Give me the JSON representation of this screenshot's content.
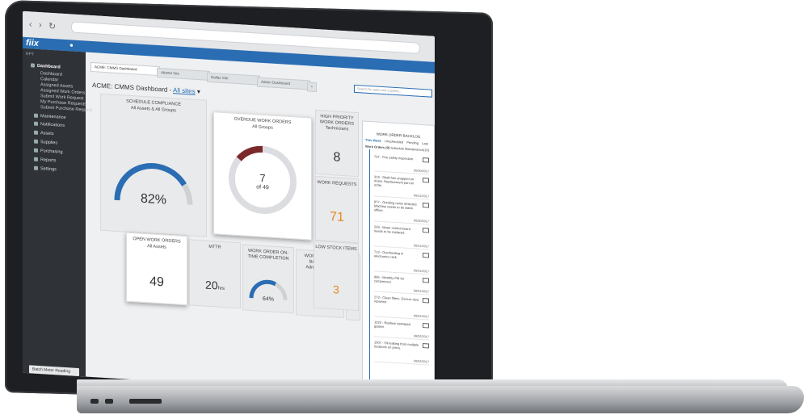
{
  "app": {
    "logo": "fiix"
  },
  "sidebar": {
    "head": "RPT",
    "dashboard": "Dashboard",
    "sub_items": [
      "Dashboard",
      "Calendar",
      "Assigned Assets",
      "Assigned Work Orders",
      "Submit Work Request",
      "My Purchase Requests",
      "Submit Purchase Request"
    ],
    "items": [
      "Maintenance",
      "Notifications",
      "Assets",
      "Supplies",
      "Purchasing",
      "Reports",
      "Settings"
    ],
    "batch": "Batch Meter Reading",
    "help": "Help",
    "logoff": "Log Off"
  },
  "tabs": [
    "ACME: CMMS Dashboard",
    "Atlanta Site",
    "Dallas Site",
    "Admin Dashboard"
  ],
  "search": {
    "placeholder": "Search for parts and supplies..."
  },
  "dashboard": {
    "title": "ACME: CMMS Dashboard -",
    "sites_link": "All sites"
  },
  "tiles": {
    "schedule": {
      "title": "SCHEDULE COMPLIANCE",
      "subtitle": "All Assets & All Groups",
      "value": "82%",
      "level": 0.82
    },
    "overdue": {
      "title": "OVERDUE WORK ORDERS",
      "subtitle": "All Groups",
      "value": "7",
      "of": "of 49",
      "level": 0.14
    },
    "high_priority": {
      "title": "HIGH PRIORITY WORK ORDERS",
      "subtitle": "Technicians",
      "value": "8"
    },
    "requests": {
      "title": "WORK REQUESTS",
      "value": "71"
    },
    "open": {
      "title": "OPEN WORK ORDERS",
      "subtitle": "All Assets",
      "value": "49"
    },
    "mttr": {
      "title": "MTTR",
      "value": "20",
      "unit": "hrs"
    },
    "ontime": {
      "title": "WORK ORDER ON-TIME COMPLETION",
      "value": "64%",
      "level": 0.64
    },
    "backlog": {
      "title": "WORK ORDER BACKLOG",
      "subtitle": "Administrators",
      "value": "1",
      "unit": "w"
    },
    "low_stock": {
      "title": "LOW STOCK ITEMS",
      "value": "3"
    }
  },
  "backlog_panel": {
    "title": "WORK ORDER BACKLOG",
    "tabs": [
      "This Week",
      "Unscheduled",
      "Pending",
      "Late"
    ],
    "filter_label": "Work Orders (9)",
    "filter_value": "Schedule Maintenance(10)",
    "rows": [
      {
        "text": "737 - Fire safety inspection.",
        "date": "05/30/2017"
      },
      {
        "text": "319 - Shaft has snapped on motor. Replacement part on order.",
        "date": "05/31/2017"
      },
      {
        "text": "877 - Grinding noise detected. Machine needs to be taken offline.",
        "date": "05/30/2017"
      },
      {
        "text": "203 - Motor control board needs to be replaced.",
        "date": "05/31/2017"
      },
      {
        "text": "713 - Overheating in electronics rack.",
        "date": "05/31/2017"
      },
      {
        "text": "985 - Monthly PM for compressor.",
        "date": "06/01/2017"
      },
      {
        "text": "273 - Clean filters. Excess dust reported.",
        "date": "06/01/2017"
      },
      {
        "text": "1023 - Replace damaged gasket.",
        "date": "06/02/2017"
      },
      {
        "text": "1007 - Oil leaking from multiple locations on press.",
        "date": "06/02/2017"
      }
    ]
  },
  "colors": {
    "brand": "#2a6db3",
    "overdue": "#7a2a2a",
    "orange": "#e58a1f",
    "sidebar": "#2f3337"
  }
}
